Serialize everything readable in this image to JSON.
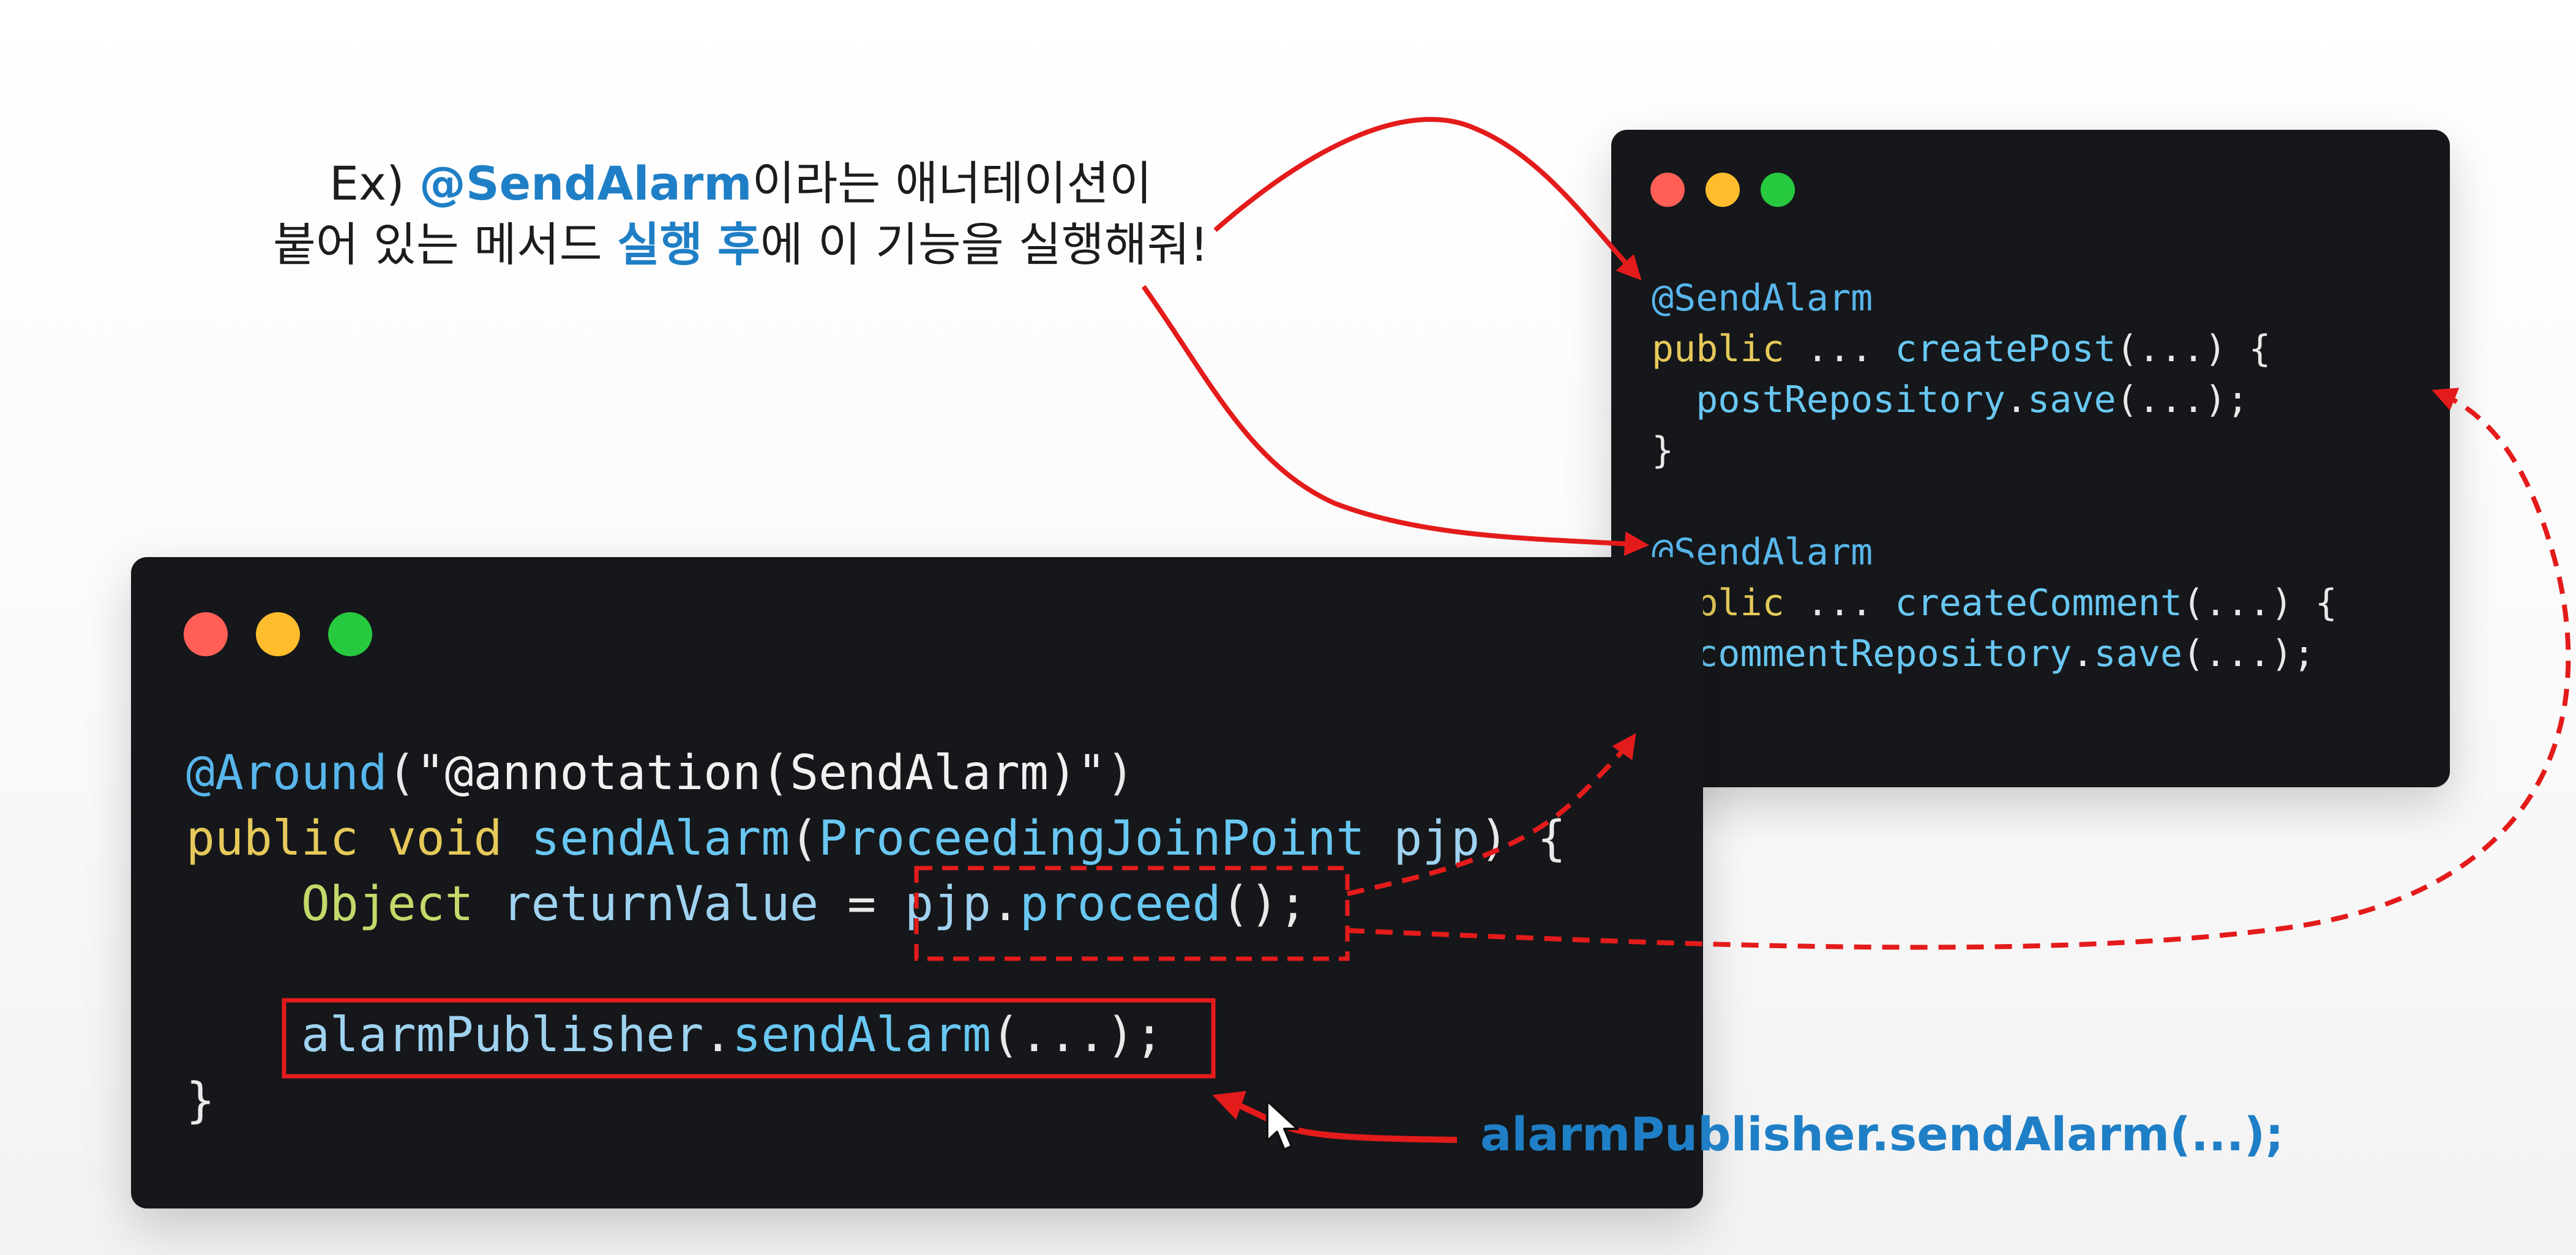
{
  "caption": {
    "line1_prefix": "Ex) ",
    "line1_highlight": "@SendAlarm",
    "line1_suffix": "이라는 애너테이션이",
    "line2_a": "붙어 있는 메서드 ",
    "line2_highlight1": "실행",
    "line2_space": " ",
    "line2_highlight2": "후",
    "line2_b": "에 이 기능을 실행해줘!"
  },
  "right_window": {
    "lines": [
      [
        {
          "t": "@SendAlarm",
          "c": "ann"
        }
      ],
      [
        {
          "t": "public",
          "c": "kw"
        },
        {
          "t": " ... ",
          "c": "punc"
        },
        {
          "t": "createPost",
          "c": "fn"
        },
        {
          "t": "(...) {",
          "c": "punc"
        }
      ],
      [
        {
          "t": "  ",
          "c": "punc"
        },
        {
          "t": "postRepository",
          "c": "fn"
        },
        {
          "t": ".",
          "c": "punc"
        },
        {
          "t": "save",
          "c": "fn"
        },
        {
          "t": "(...);",
          "c": "punc"
        }
      ],
      [
        {
          "t": "}",
          "c": "punc"
        }
      ],
      [
        {
          "t": "",
          "c": "punc"
        }
      ],
      [
        {
          "t": "@SendAlarm",
          "c": "ann"
        }
      ],
      [
        {
          "t": "public",
          "c": "kw"
        },
        {
          "t": " ... ",
          "c": "punc"
        },
        {
          "t": "createComment",
          "c": "fn"
        },
        {
          "t": "(...) {",
          "c": "punc"
        }
      ],
      [
        {
          "t": "  ",
          "c": "punc"
        },
        {
          "t": "commentRepository",
          "c": "fn"
        },
        {
          "t": ".",
          "c": "punc"
        },
        {
          "t": "save",
          "c": "fn"
        },
        {
          "t": "(...);",
          "c": "punc"
        }
      ],
      [
        {
          "t": "}",
          "c": "punc"
        }
      ]
    ]
  },
  "left_window": {
    "lines": [
      [
        {
          "t": "@Around",
          "c": "ann"
        },
        {
          "t": "(",
          "c": "punc"
        },
        {
          "t": "\"@annotation(SendAlarm)\"",
          "c": "str"
        },
        {
          "t": ")",
          "c": "punc"
        }
      ],
      [
        {
          "t": "public",
          "c": "kw"
        },
        {
          "t": " ",
          "c": "punc"
        },
        {
          "t": "void",
          "c": "kw"
        },
        {
          "t": " ",
          "c": "punc"
        },
        {
          "t": "sendAlarm",
          "c": "fn"
        },
        {
          "t": "(",
          "c": "punc"
        },
        {
          "t": "ProceedingJoinPoint",
          "c": "fn"
        },
        {
          "t": " ",
          "c": "punc"
        },
        {
          "t": "pjp",
          "c": "id"
        },
        {
          "t": ") {",
          "c": "punc"
        }
      ],
      [
        {
          "t": "    ",
          "c": "punc"
        },
        {
          "t": "Object",
          "c": "type"
        },
        {
          "t": " ",
          "c": "punc"
        },
        {
          "t": "returnValue",
          "c": "id"
        },
        {
          "t": " = ",
          "c": "punc"
        },
        {
          "t": "pjp",
          "c": "id"
        },
        {
          "t": ".",
          "c": "punc"
        },
        {
          "t": "proceed",
          "c": "fn"
        },
        {
          "t": "();",
          "c": "punc"
        }
      ],
      [
        {
          "t": "",
          "c": "punc"
        }
      ],
      [
        {
          "t": "    ",
          "c": "punc"
        },
        {
          "t": "alarmPublisher",
          "c": "id"
        },
        {
          "t": ".",
          "c": "punc"
        },
        {
          "t": "sendAlarm",
          "c": "fn"
        },
        {
          "t": "(...);",
          "c": "punc"
        }
      ],
      [
        {
          "t": "}",
          "c": "punc"
        }
      ]
    ]
  },
  "bottom_label": "alarmPublisher.sendAlarm(...);",
  "colors": {
    "highlight_blue": "#1f7fc6",
    "arrow_red": "#e41b1b",
    "window_bg": "#15171a"
  }
}
